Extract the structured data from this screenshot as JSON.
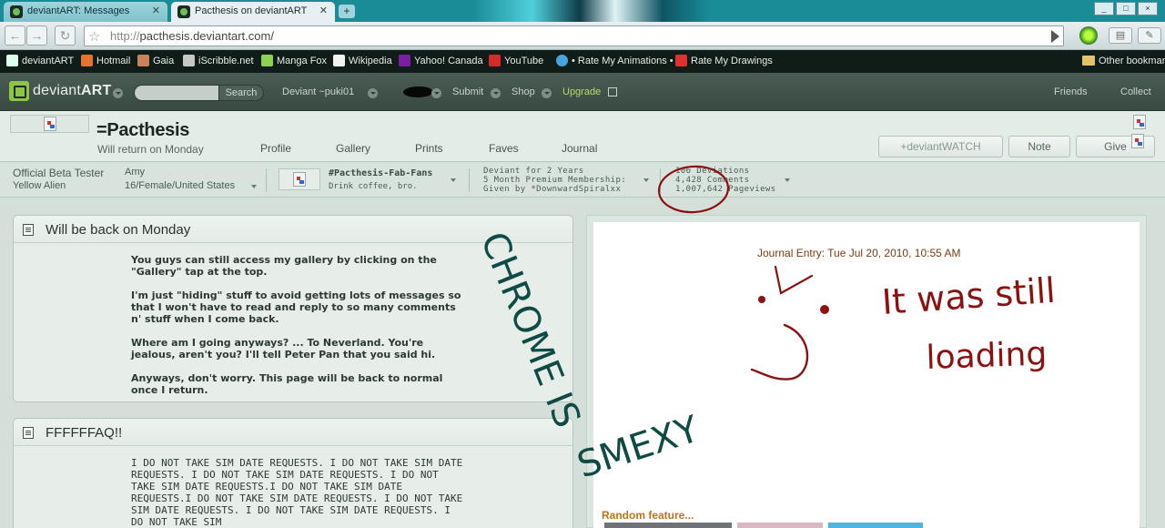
{
  "browser": {
    "tabs": [
      {
        "title": "deviantART: Messages",
        "active": false
      },
      {
        "title": "Pacthesis on deviantART",
        "active": true
      }
    ],
    "new_tab_label": "+",
    "window_controls": [
      "_",
      "□",
      "×"
    ],
    "url_protocol": "http://",
    "url_host": "pacthesis.deviantart.com/",
    "bookmarks": [
      {
        "label": "deviantART",
        "icon": "deviantart-icon",
        "color": "#2f4a3c"
      },
      {
        "label": "Hotmail",
        "icon": "hotmail-icon",
        "color": "#e6742c"
      },
      {
        "label": "Gaia",
        "icon": "gaia-icon",
        "color": "#c9835a"
      },
      {
        "label": "iScribble.net",
        "icon": "iscribble-icon",
        "color": "#c7c7c7"
      },
      {
        "label": "Manga Fox",
        "icon": "mangafox-icon",
        "color": "#8fd14f"
      },
      {
        "label": "Wikipedia",
        "icon": "wikipedia-icon",
        "color": "#f2f2f2"
      },
      {
        "label": "Yahoo! Canada",
        "icon": "yahoo-icon",
        "color": "#7b1fa2"
      },
      {
        "label": "YouTube",
        "icon": "youtube-icon",
        "color": "#d62a2a"
      },
      {
        "label": "• Rate My Animations •",
        "icon": "rate-animations-icon",
        "color": "#4aa3df"
      },
      {
        "label": "Rate My Drawings",
        "icon": "rate-drawings-icon",
        "color": "#e0312f"
      }
    ],
    "other_bookmarks": "Other bookmarks"
  },
  "da": {
    "logo_word_light": "deviant",
    "logo_word_bold": "ART",
    "search_label": "Search",
    "search_placeholder": "",
    "deviant_label": "Deviant ~puki01",
    "submit_label": "Submit",
    "shop_label": "Shop",
    "upgrade_label": "Upgrade",
    "friends_label": "Friends",
    "collect_label": "Collect"
  },
  "profile": {
    "username": "=Pacthesis",
    "tagline": "Will return on Monday",
    "tabs": [
      "Profile",
      "Gallery",
      "Prints",
      "Faves",
      "Journal"
    ],
    "watch_label": "+deviantWATCH",
    "note_label": "Note",
    "give_label": "Give",
    "title_line1": "Official Beta Tester",
    "title_line2": "Yellow Alien",
    "name": "Amy",
    "demographics": "16/Female/United States",
    "group_name": "#Pacthesis-Fab-Fans",
    "group_desc": "Drink coffee, bro.",
    "membership_line1": "Deviant for 2 Years",
    "membership_line2": "5 Month Premium Membership:",
    "membership_line3": "Given by *DownwardSpiralxx",
    "stats_line1": "106 Deviations",
    "stats_line2": "4,428 Comments",
    "stats_line3": "1,007,642 Pageviews"
  },
  "journals": [
    {
      "title": "Will be back on Monday",
      "paragraphs": [
        "You guys can still access my gallery by clicking on the \"Gallery\" tap at the top.",
        "I'm just \"hiding\" stuff to avoid getting lots of messages so that I won't have to read and reply to so many comments n' stuff when I come back.",
        "Where am I going anyways? ... To Neverland. You're jealous, aren't you? I'll tell Peter Pan that you said hi.",
        "Anyways, don't worry. This page will be back to normal once I return."
      ]
    },
    {
      "title": "FFFFFFAQ!!",
      "paragraphs": [
        "I DO NOT TAKE SIM DATE REQUESTS. I DO NOT TAKE SIM DATE REQUESTS. I DO NOT TAKE SIM DATE REQUESTS. I DO NOT TAKE SIM DATE REQUESTS.I DO NOT TAKE SIM DATE REQUESTS.I DO NOT TAKE SIM DATE REQUESTS. I DO NOT TAKE SIM DATE REQUESTS. I DO NOT TAKE SIM DATE REQUESTS. I DO NOT TAKE SIM"
      ]
    }
  ],
  "right": {
    "journal_entry": "Journal Entry: Tue Jul 20, 2010, 10:55 AM",
    "random_feature": "Random feature..."
  },
  "annotations": {
    "chrome_is": "CHROME IS",
    "smexy": "SMEXY",
    "it_was_still": "It was still",
    "loading": "loading"
  },
  "colors": {
    "ink_teal": "#0f4a44",
    "ink_red": "#8b1212",
    "da_green": "#8dc63f",
    "entry_brown": "#7a3c12"
  }
}
